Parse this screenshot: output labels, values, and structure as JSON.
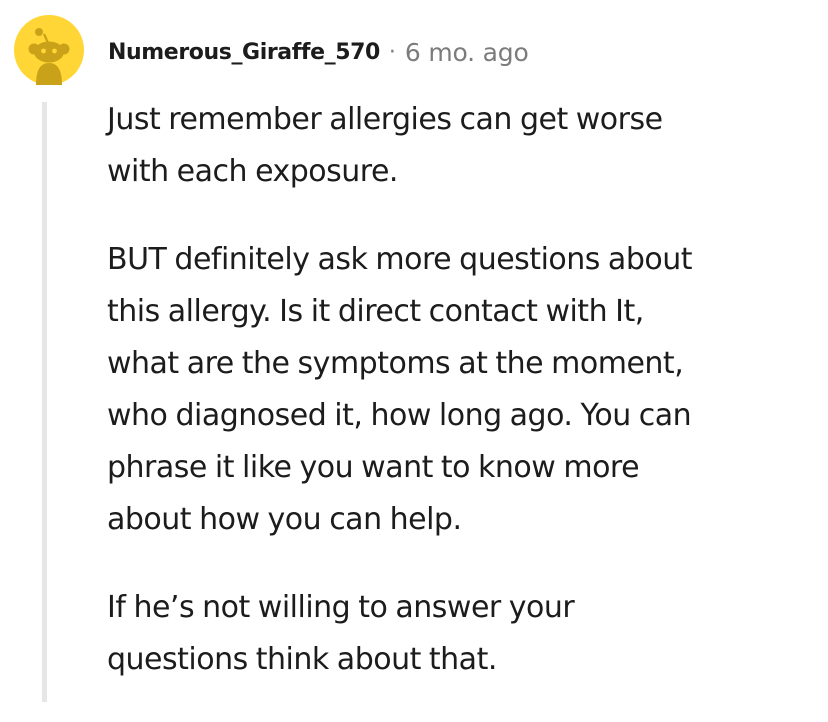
{
  "comment": {
    "author": "Numerous_Giraffe_570",
    "separator": "·",
    "timestamp": "6 mo. ago",
    "avatar_icon": "snoo-avatar-icon",
    "colors": {
      "avatar_bg": "#FFD635",
      "snoo": "#C9A219",
      "thread_line": "#E6E6E6",
      "meta_text": "#7C7C7C",
      "body_text": "#1C1C1C"
    },
    "paragraphs": [
      {
        "lines": [
          "Just remember allergies can get worse",
          "with each exposure."
        ]
      },
      {
        "lines": [
          "BUT definitely ask more questions about",
          "this allergy. Is it direct contact with It,",
          "what are the symptoms at the moment,",
          "who diagnosed it, how long ago. You can",
          "phrase it like you want to know more",
          "about how you can help."
        ]
      },
      {
        "lines": [
          "If he’s not willing to answer your",
          "questions think about that."
        ]
      }
    ]
  }
}
